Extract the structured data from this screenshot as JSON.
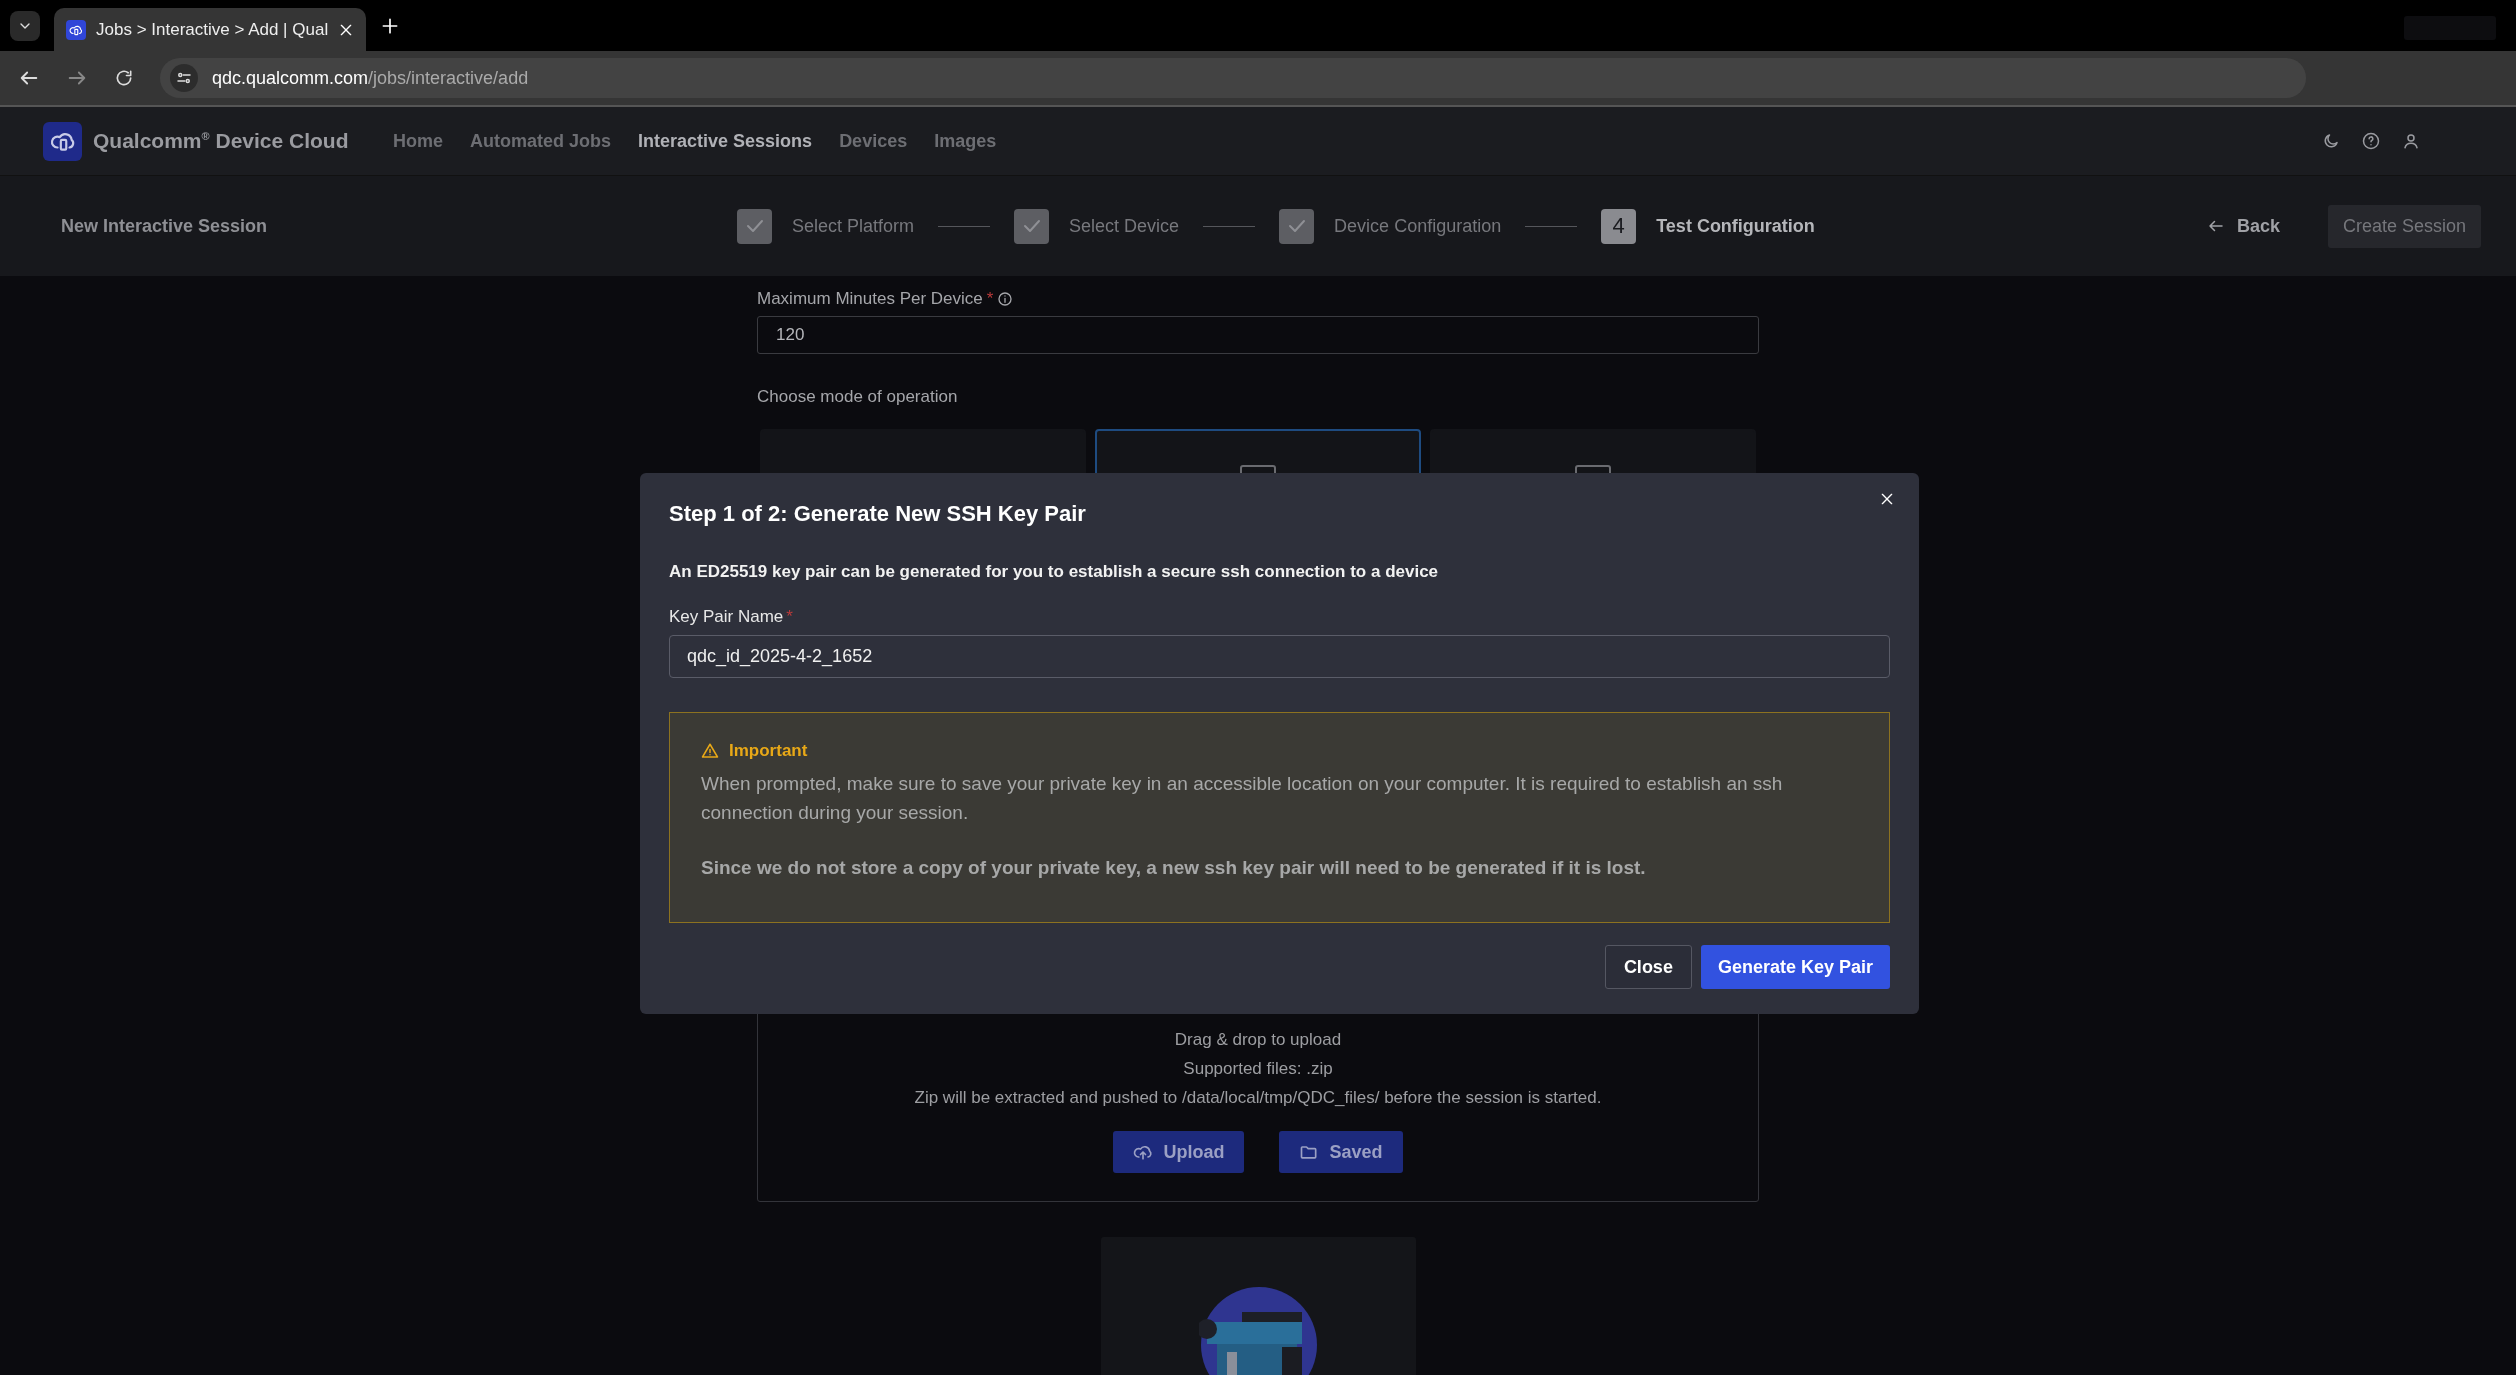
{
  "browser": {
    "tab_title": "Jobs > Interactive > Add | Qual",
    "url_host": "qdc.qualcomm.com",
    "url_path": "/jobs/interactive/add"
  },
  "app": {
    "brand": "Qualcomm",
    "brand_mark": "®",
    "brand_rest": "Device Cloud",
    "nav": [
      {
        "label": "Home",
        "selected": false
      },
      {
        "label": "Automated Jobs",
        "selected": false
      },
      {
        "label": "Interactive Sessions",
        "selected": true
      },
      {
        "label": "Devices",
        "selected": false
      },
      {
        "label": "Images",
        "selected": false
      }
    ]
  },
  "subheader": {
    "title": "New Interactive Session",
    "steps": [
      {
        "label": "Select Platform",
        "completed": true
      },
      {
        "label": "Select Device",
        "completed": true
      },
      {
        "label": "Device Configuration",
        "completed": true
      },
      {
        "label": "Test Configuration",
        "completed": false,
        "number": "4"
      }
    ],
    "back": "Back",
    "create_session": {
      "label": "Create Session",
      "disabled": true
    }
  },
  "form": {
    "max_minutes": {
      "label": "Maximum Minutes Per Device",
      "required_mark": "*",
      "value": "120"
    },
    "mode_label": "Choose mode of operation",
    "modes": [
      {
        "selected": false
      },
      {
        "selected": true
      },
      {
        "selected": false
      }
    ]
  },
  "dropzone": {
    "lines": [
      "Drag & drop to upload",
      "Supported files: .zip",
      "Zip will be extracted and pushed to /data/local/tmp/QDC_files/ before the session is started."
    ],
    "buttons": [
      {
        "label": "Upload",
        "kind": "upload"
      },
      {
        "label": "Saved",
        "kind": "saved"
      }
    ]
  },
  "modal": {
    "title": "Step 1 of 2: Generate New SSH Key Pair",
    "description": "An ED25519 key pair can be generated for you to establish a secure ssh connection to a device",
    "field": {
      "label": "Key Pair Name",
      "required_mark": "*",
      "value": "qdc_id_2025-4-2_1652"
    },
    "notice": {
      "heading": "Important",
      "paragraphs": [
        {
          "text": "When prompted, make sure to save your private key in an accessible location on your computer. It is required to establish an ssh connection during your session.",
          "emphasis": false
        },
        {
          "text": "Since we do not store a copy of your private key, a new ssh key pair will need to be generated if it is lost.",
          "emphasis": true
        }
      ]
    },
    "buttons": [
      {
        "label": "Close",
        "kind": "secondary"
      },
      {
        "label": "Generate Key Pair",
        "kind": "primary"
      }
    ]
  }
}
